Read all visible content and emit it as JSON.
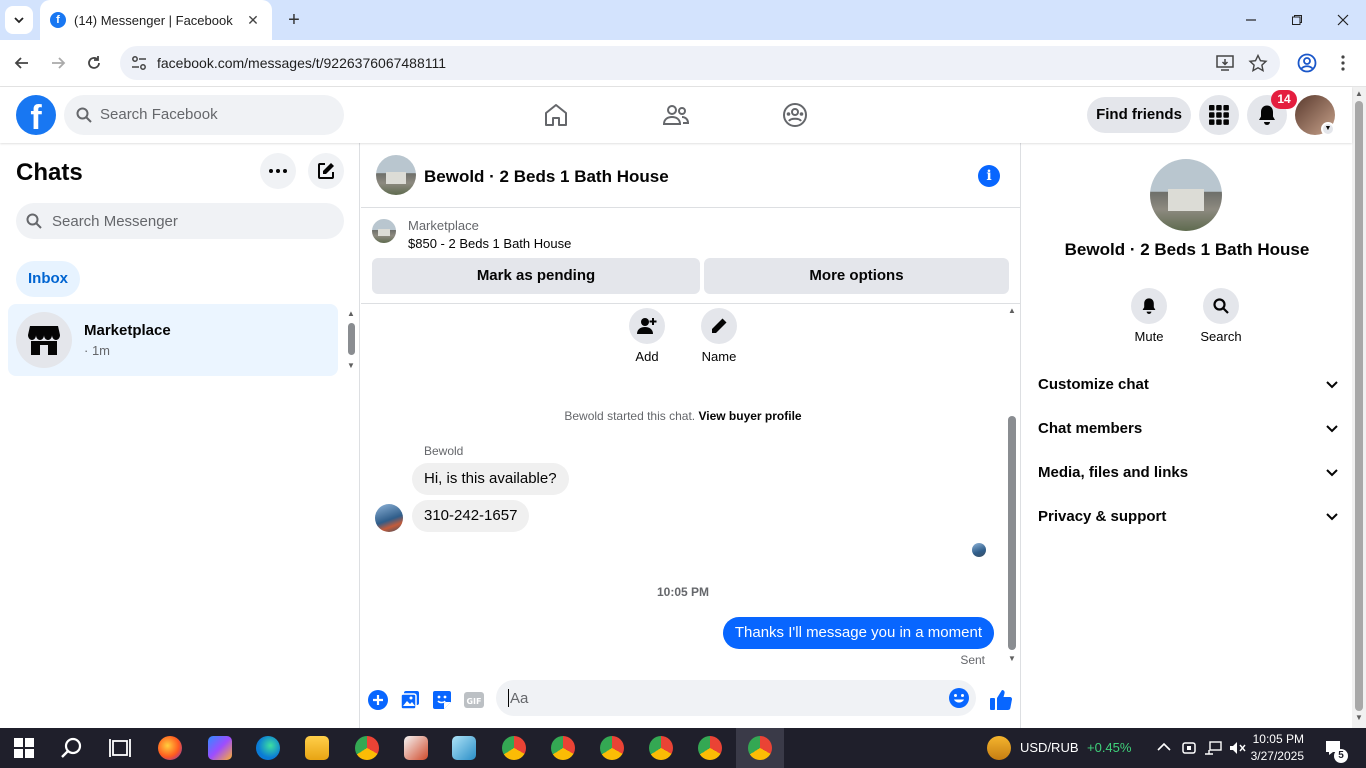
{
  "browser": {
    "tab_title": "(14) Messenger | Facebook",
    "url": "facebook.com/messages/t/9226376067488111"
  },
  "facebook": {
    "search_placeholder": "Search Facebook",
    "find_friends": "Find friends",
    "notification_count": "14"
  },
  "chat_list": {
    "title": "Chats",
    "search_placeholder": "Search Messenger",
    "filter": "Inbox",
    "items": [
      {
        "name": "Marketplace",
        "meta": "· 1m"
      }
    ]
  },
  "conversation": {
    "title": "Bewold · 2 Beds 1 Bath House",
    "marketplace_label": "Marketplace",
    "listing": "$850 - 2 Beds 1 Bath House",
    "mark_pending": "Mark as pending",
    "more_options": "More options",
    "actions": [
      {
        "label": "Add",
        "icon": "add-person-icon"
      },
      {
        "label": "Name",
        "icon": "pencil-icon"
      }
    ],
    "system_message": "Bewold started this chat.",
    "system_link": "View buyer profile",
    "sender": "Bewold",
    "incoming": [
      "Hi, is this available?",
      "310-242-1657"
    ],
    "time": "10:05 PM",
    "outgoing": "Thanks I'll message you in a moment",
    "status": "Sent",
    "composer_placeholder": "Aa"
  },
  "details": {
    "name": "Bewold · 2 Beds 1 Bath House",
    "buttons": [
      {
        "label": "Mute",
        "icon": "bell-icon"
      },
      {
        "label": "Search",
        "icon": "search-icon"
      }
    ],
    "sections": [
      "Customize chat",
      "Chat members",
      "Media, files and links",
      "Privacy & support"
    ]
  },
  "taskbar": {
    "ticker_label": "USD/RUB",
    "ticker_change": "+0.45%",
    "time": "10:05 PM",
    "date": "3/27/2025",
    "notification_count": "5"
  },
  "colors": {
    "facebook_blue": "#1877f2",
    "messenger_blue": "#0866ff",
    "selected_chat_bg": "#ebf5ff",
    "ticker_green": "#3fd17a",
    "badge_red": "#e41e3f"
  }
}
